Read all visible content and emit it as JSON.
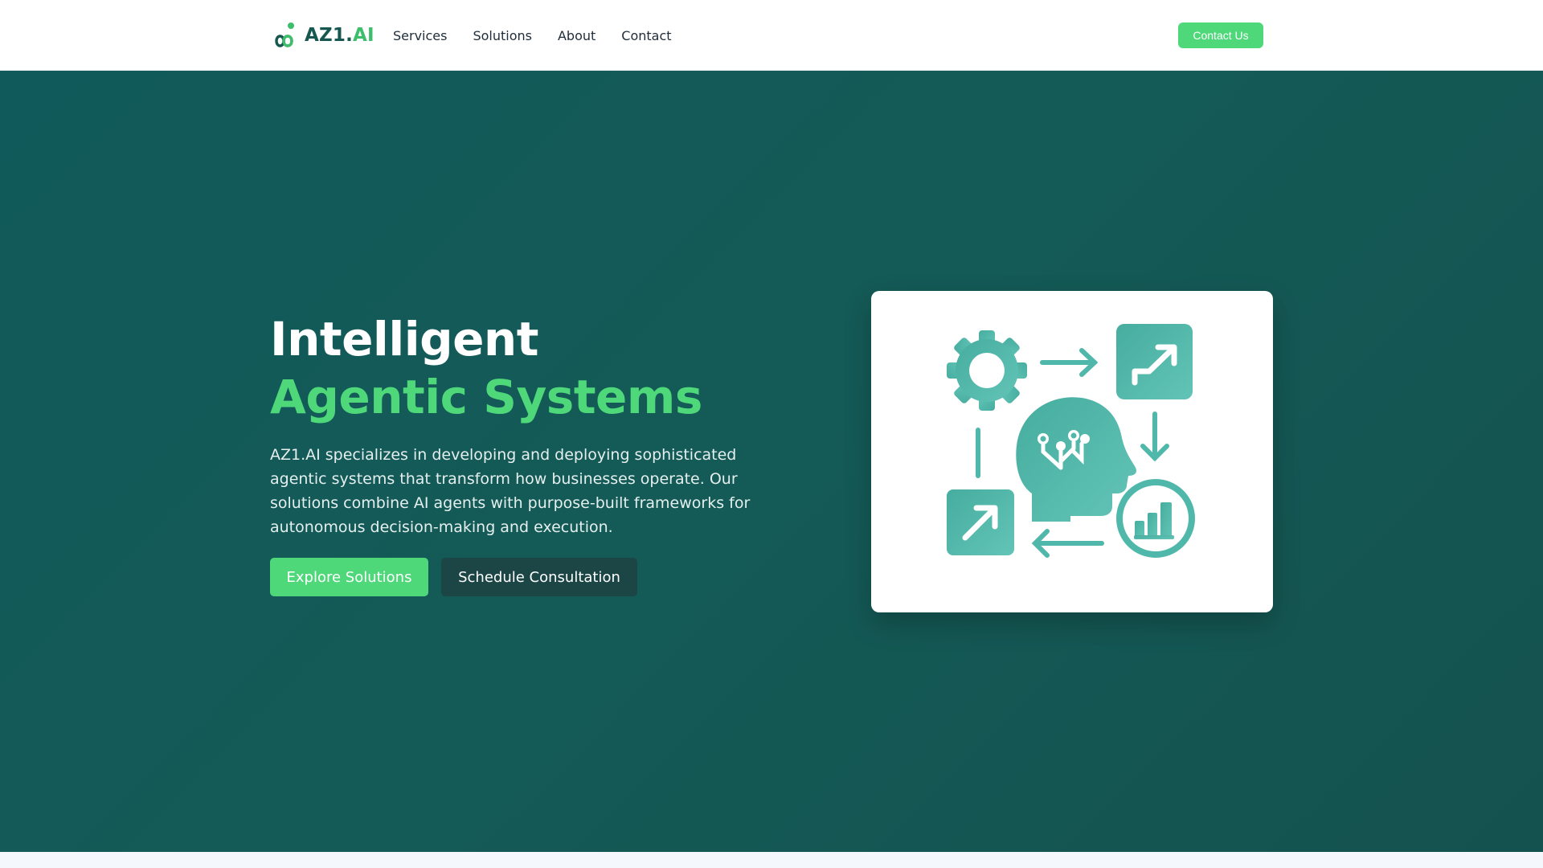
{
  "header": {
    "logo": {
      "text_primary": "AZ1.",
      "text_accent": "AI",
      "icon": "infinity-logo-icon"
    },
    "nav": [
      {
        "label": "Services"
      },
      {
        "label": "Solutions"
      },
      {
        "label": "About"
      },
      {
        "label": "Contact"
      }
    ],
    "cta_label": "Contact Us"
  },
  "hero": {
    "title_line1": "Intelligent",
    "title_line2": "Agentic Systems",
    "description": "AZ1.AI specializes in developing and deploying sophisticated agentic systems that transform how businesses operate. Our solutions combine AI agents with purpose-built frameworks for autonomous decision-making and execution.",
    "primary_button": "Explore Solutions",
    "secondary_button": "Schedule Consultation",
    "illustration": {
      "icons": [
        "gear-icon",
        "arrow-right-icon",
        "trend-up-box-icon",
        "ai-head-icon",
        "arrow-down-icon",
        "arrow-up-right-box-icon",
        "bar-chart-circle-icon",
        "arrow-left-icon",
        "line-divider-icon"
      ]
    }
  },
  "colors": {
    "brand_dark": "#16574f",
    "brand_accent": "#4ed87a",
    "hero_bg": "#135a57",
    "illustration_teal": "#4fb8aa",
    "card_bg": "#ffffff"
  }
}
